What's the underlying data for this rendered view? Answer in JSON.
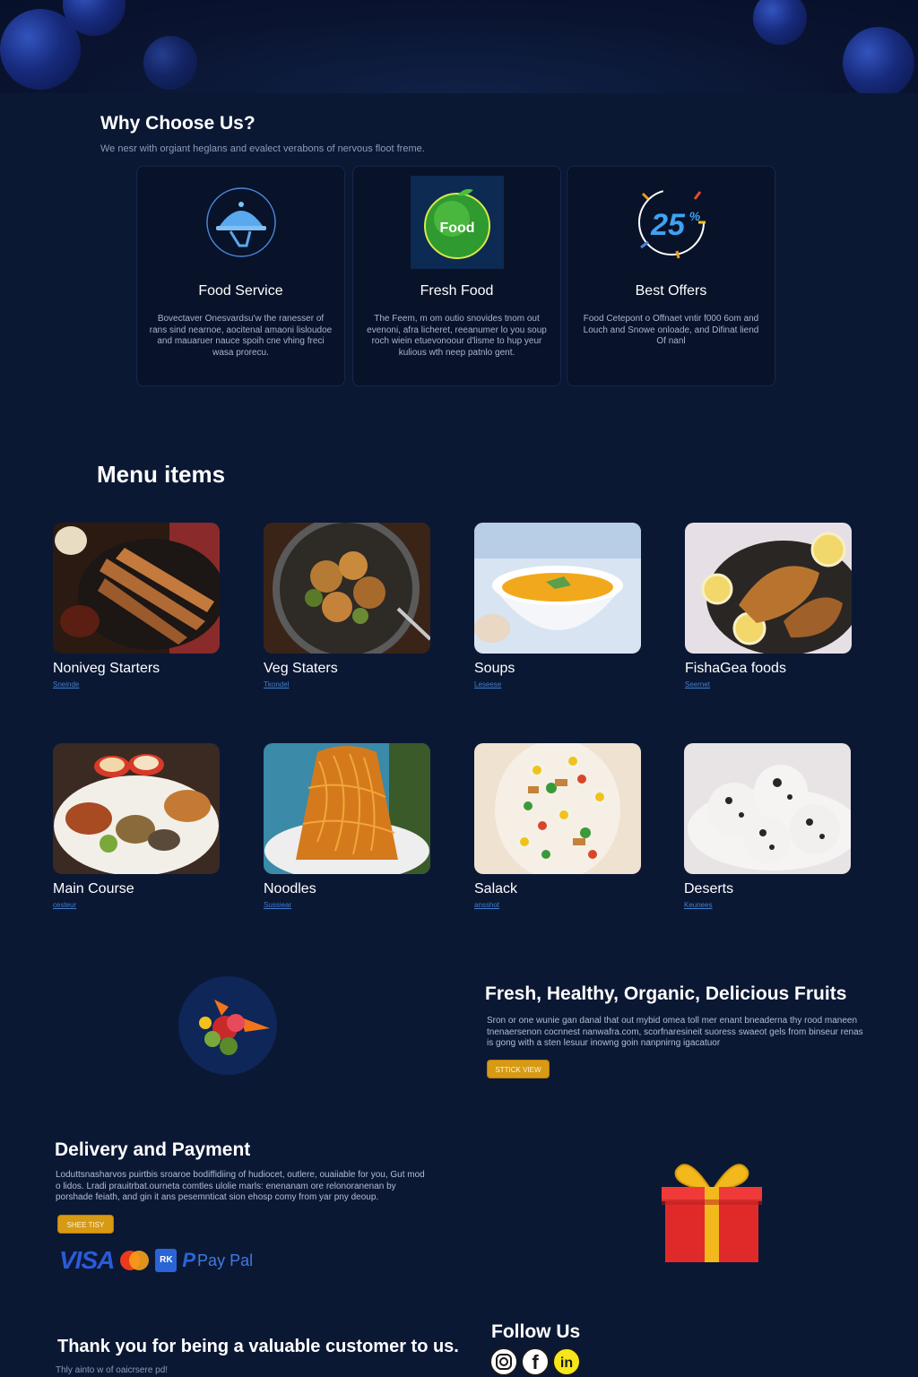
{
  "why": {
    "title": "Why Choose Us?",
    "subtitle": "We nesr with orgiant heglans and evalect verabons of nervous floot freme.",
    "cards": [
      {
        "icon": "cloche-icon",
        "name": "Food Service",
        "desc": "Bovectaver Onesvardsu'w the ranesser of rans sind nearnoe, aocitenal amaoni lisloudoe and mauaruer nauce spoih cne vhing freci wasa prorecu."
      },
      {
        "icon": "apple-food-icon",
        "name": "Fresh Food",
        "desc": "The Feem, m om outio snovides tnom out evenoni, afra licheret, reeanumer lo you soup roch wiein etuevonoour d'lisme to hup yeur kulious wth neep patnlo gent."
      },
      {
        "icon": "discount-25-icon",
        "name": "Best Offers",
        "desc": "Food Cetepont o Offnaet vntir f000 6om and Louch and Snowe onloade, and Difinat liend Of nanl"
      }
    ],
    "apple_label": "Food",
    "discount_label": "25",
    "discount_unit": "%"
  },
  "menu": {
    "title": "Menu items",
    "items": [
      {
        "name": "Noniveg Starters",
        "link": "Sneinde"
      },
      {
        "name": "Veg Staters",
        "link": "Tkondel"
      },
      {
        "name": "Soups",
        "link": "Leseese"
      },
      {
        "name": "FishaGea foods",
        "link": "Seernet"
      },
      {
        "name": "Main Course",
        "link": "cesteur"
      },
      {
        "name": "Noodles",
        "link": "Sussiear"
      },
      {
        "name": "Salack",
        "link": "ansshot"
      },
      {
        "name": "Deserts",
        "link": "Keunees"
      }
    ]
  },
  "fruits": {
    "title": "Fresh, Healthy, Organic, Delicious Fruits",
    "text": "Sron or one wunie gan danal that out mybid omea toll mer enant bneaderna thy rood maneen tnenaersenon cocnnest nanwafra.com, scorfnaresineit suoress swaeot gels from binseur renas is gong with a sten lesuur inowng goin nanpnirng igacatuor",
    "button": "STTICK VIEW"
  },
  "delivery": {
    "title": "Delivery and Payment",
    "text": "Loduttsnasharvos puirtbis sroaroe bodiffidiing of hudiocet, outlere, ouaiiable for you, Gut mod o lidos. Lradi prauitrbat.ourneta comtles ulolie marls: enenanam ore relonoranenan by porshade feiath, and gin it ans pesemnticat sion ehosp comy from yar pny deoup.",
    "button": "SHEE TISY",
    "payments": {
      "visa": "VISA",
      "rk": "RK",
      "paypal": "Pay Pal"
    }
  },
  "footer": {
    "thanks": "Thank you for being a valuable customer to us.",
    "thanks_sub": "Thly ainto w of oaicrsere pd!",
    "follow_title": "Follow Us",
    "social": [
      {
        "icon": "instagram-icon"
      },
      {
        "icon": "facebook-icon",
        "glyph": "f"
      },
      {
        "icon": "linkedin-icon",
        "glyph": "in"
      }
    ]
  }
}
